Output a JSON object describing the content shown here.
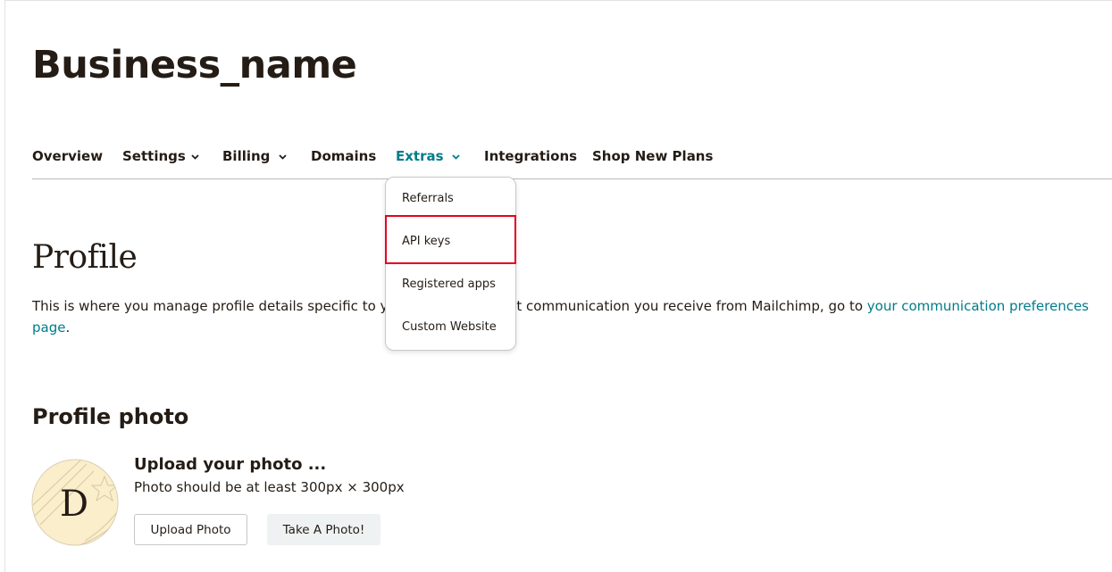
{
  "business_title": "Business_name",
  "nav": {
    "items": [
      {
        "label": "Overview"
      },
      {
        "label": "Settings"
      },
      {
        "label": "Billing"
      },
      {
        "label": "Domains"
      },
      {
        "label": "Extras"
      },
      {
        "label": "Integrations"
      },
      {
        "label": "Shop New Plans"
      }
    ],
    "active": "Extras"
  },
  "extras_menu": {
    "items": [
      {
        "label": "Referrals"
      },
      {
        "label": "API keys"
      },
      {
        "label": "Registered apps"
      },
      {
        "label": "Custom Website"
      }
    ],
    "highlighted": "API keys"
  },
  "profile": {
    "heading": "Profile",
    "desc_before": "This is where you manage profile details specific to y",
    "desc_middle": "t communication you receive from Mailchimp, go to ",
    "desc_link": "your communication preferences page",
    "desc_end": "."
  },
  "profile_photo": {
    "heading": "Profile photo",
    "avatar_letter": "D",
    "upload_title": "Upload your photo ...",
    "upload_hint": "Photo should be at least 300px × 300px",
    "upload_button": "Upload Photo",
    "take_photo_button": "Take A Photo!"
  },
  "colors": {
    "accent": "#007c89",
    "highlight_border": "#e8001c",
    "avatar_bg": "#fbeecb"
  }
}
